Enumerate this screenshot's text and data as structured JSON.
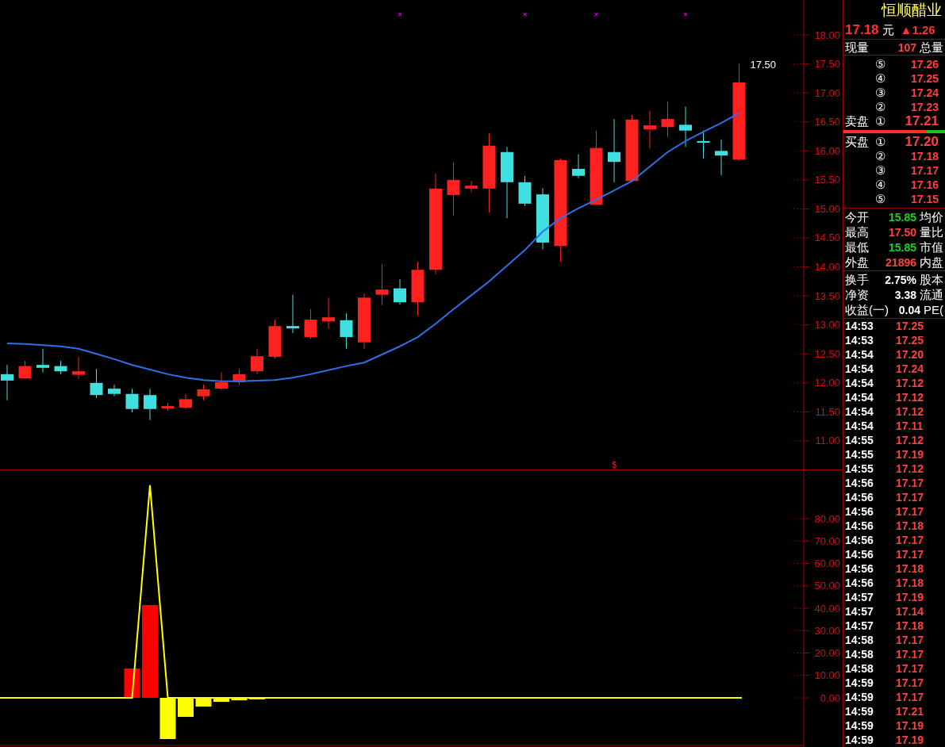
{
  "price_chart": {
    "price_axis": [
      "18.00",
      "17.50",
      "17.00",
      "16.50",
      "16.00",
      "15.50",
      "15.00",
      "14.50",
      "14.00",
      "13.50",
      "13.00",
      "12.50",
      "12.00",
      "11.50",
      "11.00"
    ],
    "high_label": "17.50",
    "signal_marks": [
      "×",
      "×",
      "×",
      "×"
    ],
    "bottom_mark": "$"
  },
  "indicator_chart": {
    "value_axis": [
      "80.00",
      "70.00",
      "60.00",
      "50.00",
      "40.00",
      "30.00",
      "20.00",
      "10.00",
      "0.00"
    ]
  },
  "quote": {
    "name": "恒顺醋业",
    "price": "17.18",
    "unit": "元",
    "change": "▲1.26"
  },
  "volume_row": {
    "label": "现量",
    "value": "107",
    "label2": "总量"
  },
  "asks": [
    {
      "rank": "⑤",
      "price": "17.26"
    },
    {
      "rank": "④",
      "price": "17.25"
    },
    {
      "rank": "③",
      "price": "17.24"
    },
    {
      "rank": "②",
      "price": "17.23"
    },
    {
      "side": "卖盘",
      "rank": "①",
      "price": "17.21"
    }
  ],
  "order_ratio": {
    "level": 0.82
  },
  "bids": [
    {
      "side": "买盘",
      "rank": "①",
      "price": "17.20"
    },
    {
      "rank": "②",
      "price": "17.18"
    },
    {
      "rank": "③",
      "price": "17.17"
    },
    {
      "rank": "④",
      "price": "17.16"
    },
    {
      "rank": "⑤",
      "price": "17.15"
    }
  ],
  "stats": [
    {
      "label": "今开",
      "value": "15.85",
      "color": "#20d020",
      "label2": "均价"
    },
    {
      "label": "最高",
      "value": "17.50",
      "color": "#ff4040",
      "label2": "量比"
    },
    {
      "label": "最低",
      "value": "15.85",
      "color": "#20d020",
      "label2": "市值"
    },
    {
      "label": "外盘",
      "value": "21896",
      "color": "#ff4040",
      "label2": "内盘"
    }
  ],
  "stats2": [
    {
      "label": "换手",
      "value": "2.75%",
      "label2": "股本"
    },
    {
      "label": "净资",
      "value": "3.38",
      "label2": "流通"
    },
    {
      "label": "收益(一)",
      "value": "0.04",
      "label2": "PE("
    }
  ],
  "ticks": [
    {
      "time": "14:53",
      "price": "17.25"
    },
    {
      "time": "14:53",
      "price": "17.25"
    },
    {
      "time": "14:54",
      "price": "17.20"
    },
    {
      "time": "14:54",
      "price": "17.24"
    },
    {
      "time": "14:54",
      "price": "17.12"
    },
    {
      "time": "14:54",
      "price": "17.12"
    },
    {
      "time": "14:54",
      "price": "17.12"
    },
    {
      "time": "14:54",
      "price": "17.11"
    },
    {
      "time": "14:55",
      "price": "17.12"
    },
    {
      "time": "14:55",
      "price": "17.19"
    },
    {
      "time": "14:55",
      "price": "17.12"
    },
    {
      "time": "14:56",
      "price": "17.17"
    },
    {
      "time": "14:56",
      "price": "17.17"
    },
    {
      "time": "14:56",
      "price": "17.17"
    },
    {
      "time": "14:56",
      "price": "17.18"
    },
    {
      "time": "14:56",
      "price": "17.17"
    },
    {
      "time": "14:56",
      "price": "17.17"
    },
    {
      "time": "14:56",
      "price": "17.18"
    },
    {
      "time": "14:56",
      "price": "17.18"
    },
    {
      "time": "14:57",
      "price": "17.19"
    },
    {
      "time": "14:57",
      "price": "17.14"
    },
    {
      "time": "14:57",
      "price": "17.18"
    },
    {
      "time": "14:58",
      "price": "17.17"
    },
    {
      "time": "14:58",
      "price": "17.17"
    },
    {
      "time": "14:58",
      "price": "17.17"
    },
    {
      "time": "14:59",
      "price": "17.17"
    },
    {
      "time": "14:59",
      "price": "17.17"
    },
    {
      "time": "14:59",
      "price": "17.21"
    },
    {
      "time": "14:59",
      "price": "17.19"
    },
    {
      "time": "14:59",
      "price": "17.19"
    }
  ]
}
